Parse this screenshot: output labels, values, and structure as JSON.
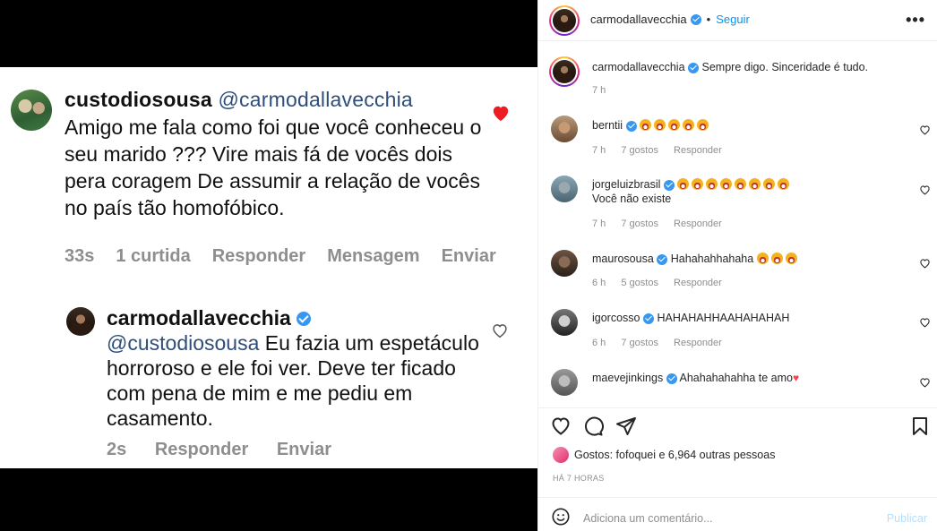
{
  "post_image": {
    "comment1": {
      "username": "custodiosousa",
      "mention": "@carmodallavecchia",
      "text": "Amigo me  fala como foi que você conheceu o seu marido ??? Vire mais fá de vocês dois pera coragem  De assumir a relação de vocês no país tão homofóbico.",
      "time": "33s",
      "likes": "1 curtida",
      "reply": "Responder",
      "message": "Mensagem",
      "send": "Enviar"
    },
    "comment2": {
      "username": "carmodallavecchia",
      "mention": "@custodiosousa",
      "text": " Eu fazia um espetáculo horroroso e ele foi ver. Deve ter ficado com pena de mim e me pediu em casamento.",
      "time": "2s",
      "reply": "Responder",
      "send": "Enviar"
    }
  },
  "header": {
    "username": "carmodallavecchia",
    "separator": "•",
    "follow": "Seguir",
    "more": "•••"
  },
  "caption": {
    "username": "carmodallavecchia",
    "text": "Sempre digo. Sinceridade é tudo.",
    "time": "7 h"
  },
  "comments": [
    {
      "username": "berntii",
      "verified": true,
      "text": "",
      "emoji_count": 5,
      "time": "7 h",
      "likes": "7 gostos",
      "reply": "Responder"
    },
    {
      "username": "jorgeluizbrasil",
      "verified": true,
      "text": "Você não existe",
      "emoji_count": 8,
      "time": "7 h",
      "likes": "7 gostos",
      "reply": "Responder"
    },
    {
      "username": "maurosousa",
      "verified": true,
      "text": "Hahahahhahaha",
      "emoji_count": 3,
      "time": "6 h",
      "likes": "5 gostos",
      "reply": "Responder"
    },
    {
      "username": "igorcosso",
      "verified": true,
      "text": "HAHAHAHHAAHAHAHAH",
      "emoji_count": 0,
      "time": "6 h",
      "likes": "7 gostos",
      "reply": "Responder"
    },
    {
      "username": "maevejinkings",
      "verified": true,
      "text": "Ahahahahahha te amo",
      "emoji_count": 0,
      "time": "",
      "likes": "",
      "reply": ""
    }
  ],
  "likes_line": {
    "prefix": "Gostos: ",
    "user": "fofoquei",
    "rest": " e 6,964 outras pessoas"
  },
  "time_ago": "HÁ 7 HORAS",
  "add_comment": {
    "placeholder": "Adiciona um comentário...",
    "publish": "Publicar"
  },
  "colors": {
    "accent": "#0095f6",
    "heart_red": "#ed4956",
    "mention_blue": "#2e4d7b"
  }
}
